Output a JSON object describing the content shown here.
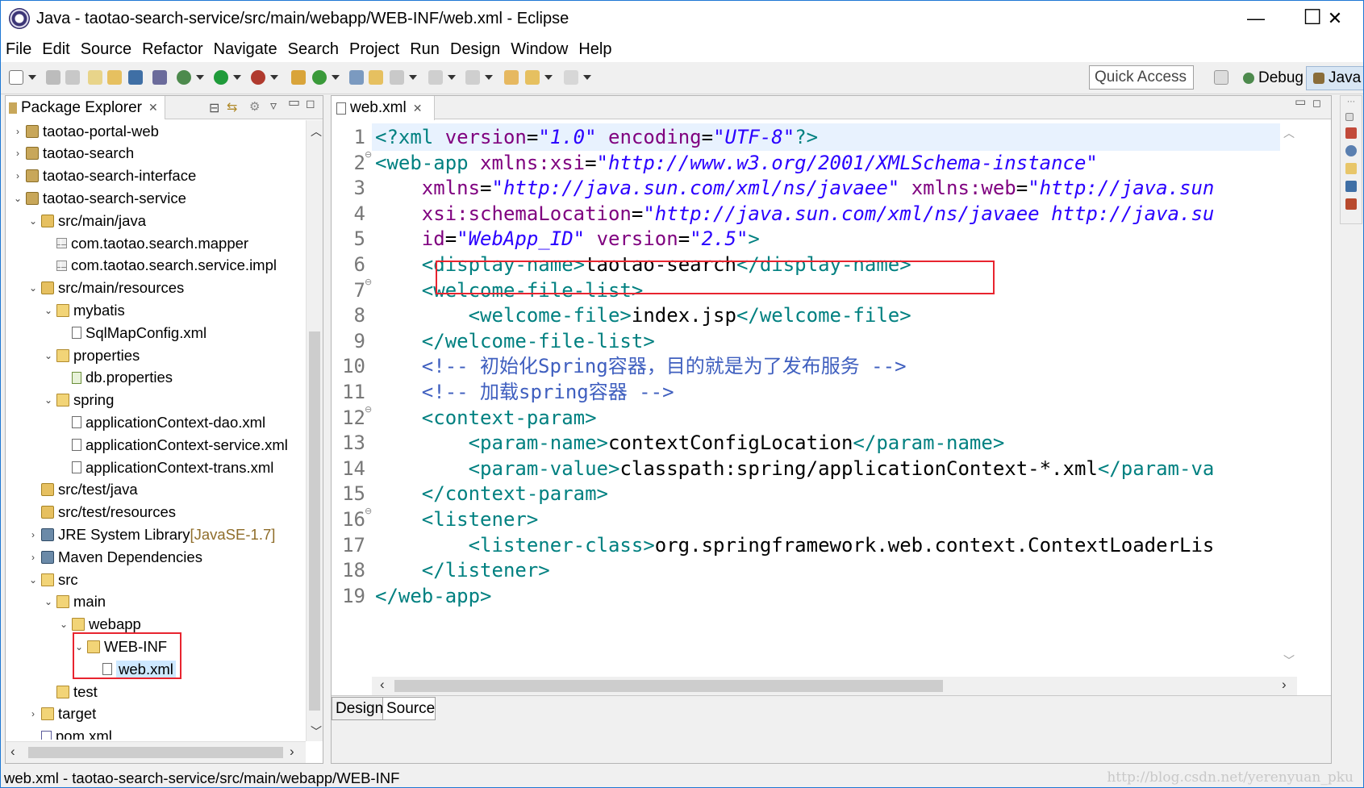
{
  "window": {
    "title": "Java - taotao-search-service/src/main/webapp/WEB-INF/web.xml - Eclipse",
    "minimize": "—",
    "maximize": "☐",
    "close": "✕"
  },
  "menu": [
    "File",
    "Edit",
    "Source",
    "Refactor",
    "Navigate",
    "Search",
    "Project",
    "Run",
    "Design",
    "Window",
    "Help"
  ],
  "toolbar": {
    "quick_access": "Quick Access",
    "perspectives": [
      "Debug",
      "Java"
    ]
  },
  "package_explorer": {
    "tab_label": "Package Explorer",
    "tree": [
      {
        "label": "taotao-portal-web",
        "depth": 0,
        "icon": "project-icon",
        "arrow": "›"
      },
      {
        "label": "taotao-search",
        "depth": 0,
        "icon": "project-icon",
        "arrow": "›"
      },
      {
        "label": "taotao-search-interface",
        "depth": 0,
        "icon": "project-icon",
        "arrow": "›"
      },
      {
        "label": "taotao-search-service",
        "depth": 0,
        "icon": "project-icon",
        "arrow": "⌄"
      },
      {
        "label": "src/main/java",
        "depth": 1,
        "icon": "source-folder-icon",
        "arrow": "⌄"
      },
      {
        "label": "com.taotao.search.mapper",
        "depth": 2,
        "icon": "package-icon",
        "arrow": ""
      },
      {
        "label": "com.taotao.search.service.impl",
        "depth": 2,
        "icon": "package-icon",
        "arrow": ""
      },
      {
        "label": "src/main/resources",
        "depth": 1,
        "icon": "source-folder-icon",
        "arrow": "⌄"
      },
      {
        "label": "mybatis",
        "depth": 2,
        "icon": "folder-icon",
        "arrow": "⌄"
      },
      {
        "label": "SqlMapConfig.xml",
        "depth": 3,
        "icon": "xml-file-icon",
        "arrow": ""
      },
      {
        "label": "properties",
        "depth": 2,
        "icon": "folder-icon",
        "arrow": "⌄"
      },
      {
        "label": "db.properties",
        "depth": 3,
        "icon": "properties-file-icon",
        "arrow": ""
      },
      {
        "label": "spring",
        "depth": 2,
        "icon": "folder-icon",
        "arrow": "⌄"
      },
      {
        "label": "applicationContext-dao.xml",
        "depth": 3,
        "icon": "xml-file-icon",
        "arrow": ""
      },
      {
        "label": "applicationContext-service.xml",
        "depth": 3,
        "icon": "xml-file-icon",
        "arrow": ""
      },
      {
        "label": "applicationContext-trans.xml",
        "depth": 3,
        "icon": "xml-file-icon",
        "arrow": ""
      },
      {
        "label": "src/test/java",
        "depth": 1,
        "icon": "source-folder-icon",
        "arrow": ""
      },
      {
        "label": "src/test/resources",
        "depth": 1,
        "icon": "source-folder-icon",
        "arrow": ""
      },
      {
        "label": "JRE System Library",
        "suffix": " [JavaSE-1.7]",
        "depth": 1,
        "icon": "library-icon",
        "arrow": "›"
      },
      {
        "label": "Maven Dependencies",
        "depth": 1,
        "icon": "library-icon",
        "arrow": "›"
      },
      {
        "label": "src",
        "depth": 1,
        "icon": "folder-icon",
        "arrow": "⌄"
      },
      {
        "label": "main",
        "depth": 2,
        "icon": "folder-icon",
        "arrow": "⌄"
      },
      {
        "label": "webapp",
        "depth": 3,
        "icon": "folder-icon",
        "arrow": "⌄"
      },
      {
        "label": "WEB-INF",
        "depth": 4,
        "icon": "folder-icon",
        "arrow": "⌄"
      },
      {
        "label": "web.xml",
        "depth": 5,
        "icon": "xml-file-icon",
        "arrow": "",
        "selected": true
      },
      {
        "label": "test",
        "depth": 2,
        "icon": "folder-icon",
        "arrow": ""
      },
      {
        "label": "target",
        "depth": 1,
        "icon": "folder-icon",
        "arrow": "›"
      },
      {
        "label": "pom.xml",
        "depth": 1,
        "icon": "maven-pom-icon",
        "arrow": ""
      }
    ]
  },
  "editor": {
    "tab_label": "web.xml",
    "bottom_tabs": [
      "Design",
      "Source"
    ],
    "lines": [
      [
        [
          "tg",
          "<?xml "
        ],
        [
          "at",
          "version"
        ],
        [
          "tx",
          "="
        ],
        [
          "av",
          "\"1.0\""
        ],
        [
          "tx",
          " "
        ],
        [
          "at",
          "encoding"
        ],
        [
          "tx",
          "="
        ],
        [
          "av",
          "\"UTF-8\""
        ],
        [
          "tg",
          "?>"
        ]
      ],
      [
        [
          "tg",
          "<web-app "
        ],
        [
          "at",
          "xmlns:xsi"
        ],
        [
          "tx",
          "="
        ],
        [
          "av",
          "\"http://www.w3.org/2001/XMLSchema-instance\""
        ]
      ],
      [
        [
          "tx",
          "    "
        ],
        [
          "at",
          "xmlns"
        ],
        [
          "tx",
          "="
        ],
        [
          "av",
          "\"http://java.sun.com/xml/ns/javaee\""
        ],
        [
          "tx",
          " "
        ],
        [
          "at",
          "xmlns:web"
        ],
        [
          "tx",
          "="
        ],
        [
          "av",
          "\"http://java.sun"
        ]
      ],
      [
        [
          "tx",
          "    "
        ],
        [
          "at",
          "xsi:schemaLocation"
        ],
        [
          "tx",
          "="
        ],
        [
          "av",
          "\"http://java.sun.com/xml/ns/javaee http://java.su"
        ]
      ],
      [
        [
          "tx",
          "    "
        ],
        [
          "at",
          "id"
        ],
        [
          "tx",
          "="
        ],
        [
          "av",
          "\"WebApp_ID\""
        ],
        [
          "tx",
          " "
        ],
        [
          "at",
          "version"
        ],
        [
          "tx",
          "="
        ],
        [
          "av",
          "\"2.5\""
        ],
        [
          "tg",
          ">"
        ]
      ],
      [
        [
          "tx",
          "    "
        ],
        [
          "tg",
          "<display-name>"
        ],
        [
          "tx",
          "taotao-search"
        ],
        [
          "tg",
          "</display-name>"
        ]
      ],
      [
        [
          "tx",
          "    "
        ],
        [
          "tg",
          "<welcome-file-list>"
        ]
      ],
      [
        [
          "tx",
          "        "
        ],
        [
          "tg",
          "<welcome-file>"
        ],
        [
          "tx",
          "index.jsp"
        ],
        [
          "tg",
          "</welcome-file>"
        ]
      ],
      [
        [
          "tx",
          "    "
        ],
        [
          "tg",
          "</welcome-file-list>"
        ]
      ],
      [
        [
          "tx",
          "    "
        ],
        [
          "cm",
          "<!-- 初始化Spring容器，目的就是为了发布服务 -->"
        ]
      ],
      [
        [
          "tx",
          "    "
        ],
        [
          "cm",
          "<!-- 加载spring容器 -->"
        ]
      ],
      [
        [
          "tx",
          "    "
        ],
        [
          "tg",
          "<context-param>"
        ]
      ],
      [
        [
          "tx",
          "        "
        ],
        [
          "tg",
          "<param-name>"
        ],
        [
          "tx",
          "contextConfigLocation"
        ],
        [
          "tg",
          "</param-name>"
        ]
      ],
      [
        [
          "tx",
          "        "
        ],
        [
          "tg",
          "<param-value>"
        ],
        [
          "tx",
          "classpath:spring/applicationContext-*.xml"
        ],
        [
          "tg",
          "</param-va"
        ]
      ],
      [
        [
          "tx",
          "    "
        ],
        [
          "tg",
          "</context-param>"
        ]
      ],
      [
        [
          "tx",
          "    "
        ],
        [
          "tg",
          "<listener>"
        ]
      ],
      [
        [
          "tx",
          "        "
        ],
        [
          "tg",
          "<listener-class>"
        ],
        [
          "tx",
          "org.springframework.web.context.ContextLoaderLis"
        ]
      ],
      [
        [
          "tx",
          "    "
        ],
        [
          "tg",
          "</listener>"
        ]
      ],
      [
        [
          "tg",
          "</web-app>"
        ]
      ]
    ],
    "fold_lines": [
      2,
      7,
      12,
      16
    ]
  },
  "status": {
    "path": "web.xml - taotao-search-service/src/main/webapp/WEB-INF"
  },
  "watermark": "http://blog.csdn.net/yerenyuan_pku",
  "colors": {
    "highlight_box": "#e8242f",
    "selection": "#cde8ff"
  }
}
